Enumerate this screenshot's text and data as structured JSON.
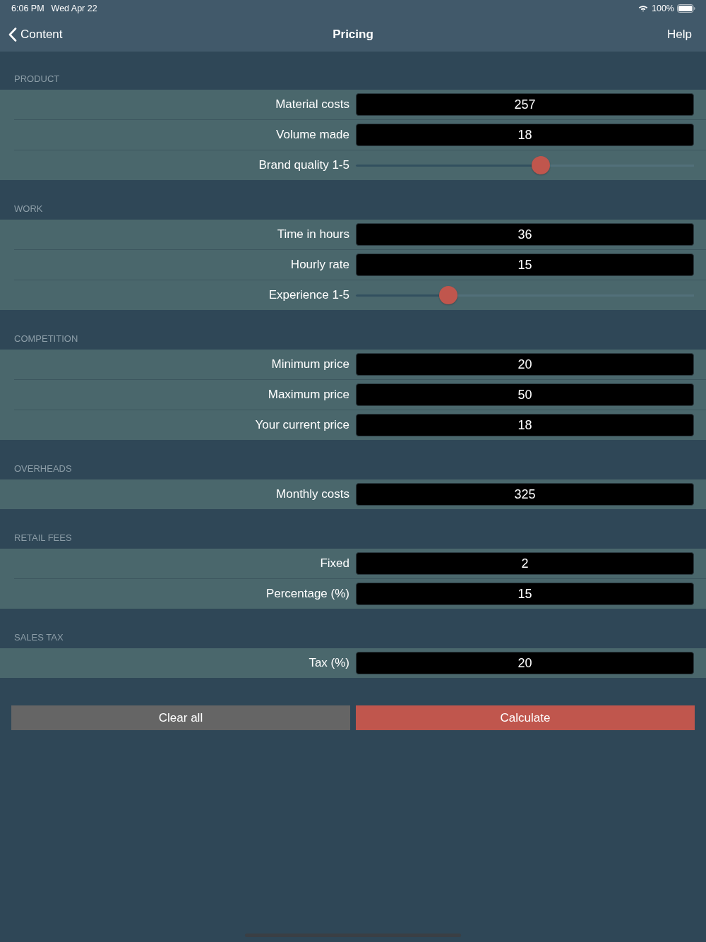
{
  "status_bar": {
    "time": "6:06 PM",
    "date": "Wed Apr 22",
    "battery": "100%"
  },
  "nav_bar": {
    "back": "Content",
    "title": "Pricing",
    "action": "Help"
  },
  "sections": [
    {
      "header": "PRODUCT",
      "rows": [
        {
          "kind": "field",
          "label": "Material costs",
          "value": "257"
        },
        {
          "kind": "field",
          "label": "Volume made",
          "value": "18"
        },
        {
          "kind": "slider",
          "label": "Brand quality 1-5",
          "level": 0.55
        }
      ]
    },
    {
      "header": "WORK",
      "rows": [
        {
          "kind": "field",
          "label": "Time in hours",
          "value": "36"
        },
        {
          "kind": "field",
          "label": "Hourly rate",
          "value": "15"
        },
        {
          "kind": "slider",
          "label": "Experience 1-5",
          "level": 0.26
        }
      ]
    },
    {
      "header": "COMPETITION",
      "rows": [
        {
          "kind": "field",
          "label": "Minimum price",
          "value": "20"
        },
        {
          "kind": "field",
          "label": "Maximum price",
          "value": "50"
        },
        {
          "kind": "field",
          "label": "Your current price",
          "value": "18"
        }
      ]
    },
    {
      "header": "OVERHEADS",
      "rows": [
        {
          "kind": "field",
          "label": "Monthly costs",
          "value": "325"
        }
      ]
    },
    {
      "header": "RETAIL FEES",
      "rows": [
        {
          "kind": "field",
          "label": "Fixed",
          "value": "2"
        },
        {
          "kind": "field",
          "label": "Percentage (%)",
          "value": "15"
        }
      ]
    },
    {
      "header": "SALES TAX",
      "rows": [
        {
          "kind": "field",
          "label": "Tax (%)",
          "value": "20"
        }
      ]
    }
  ],
  "buttons": [
    {
      "kind": "secondary",
      "label": "Clear all"
    },
    {
      "kind": "primary",
      "label": "Calculate"
    }
  ]
}
